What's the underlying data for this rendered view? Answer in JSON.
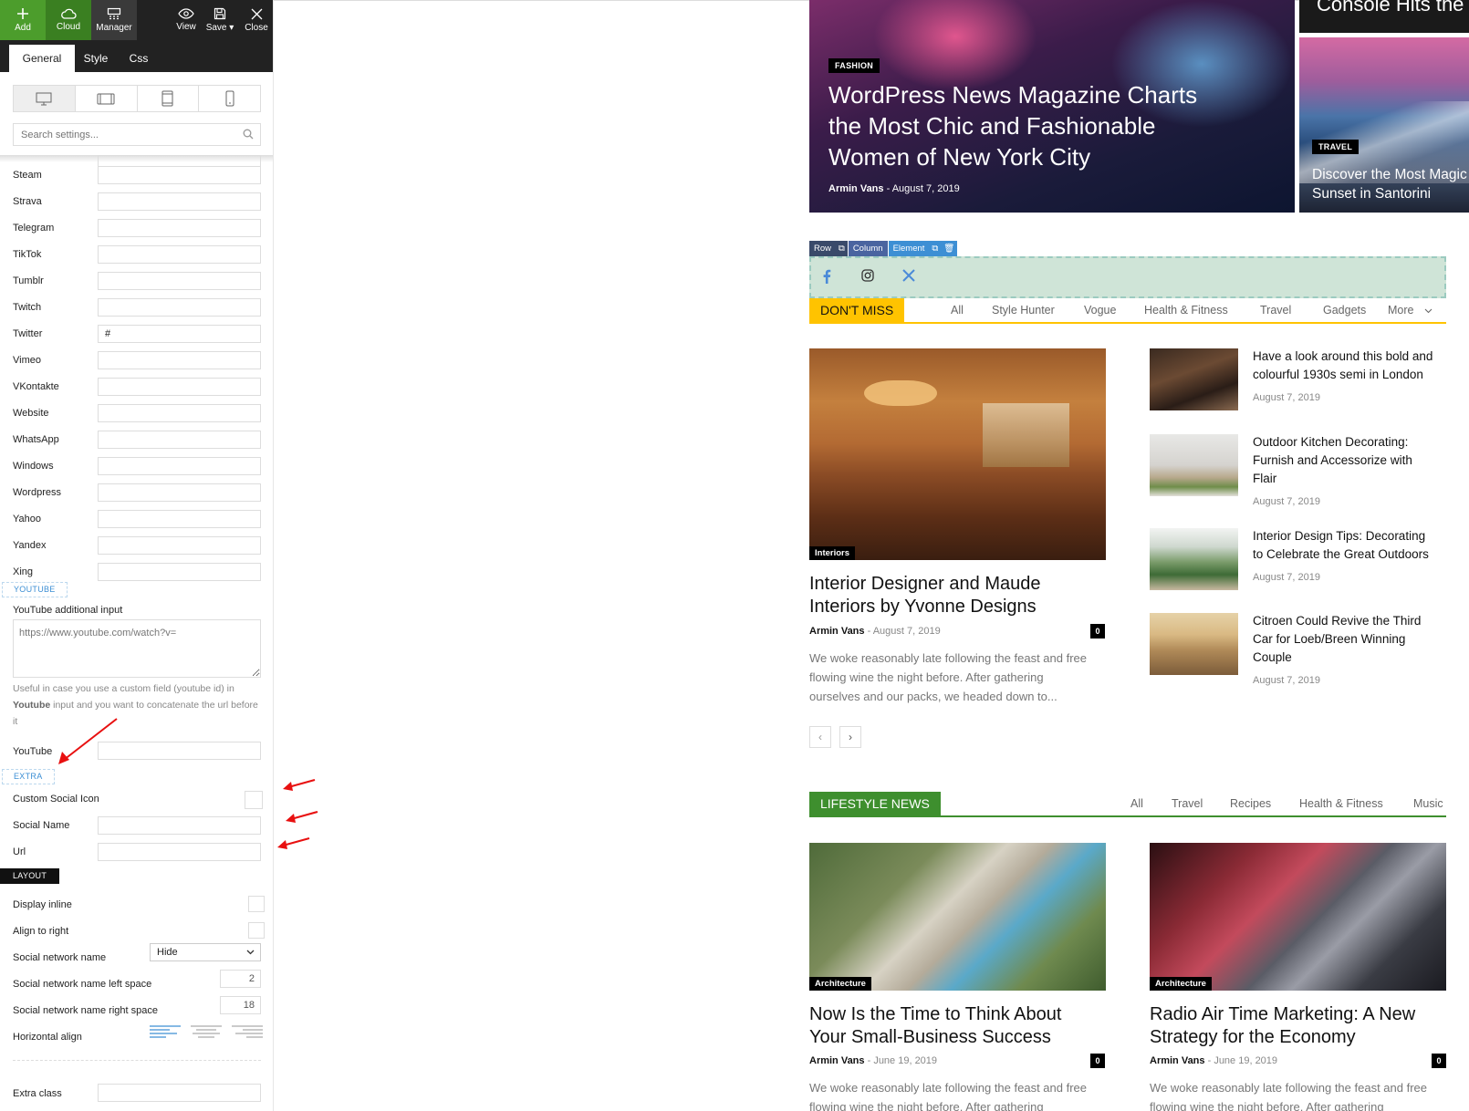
{
  "toolbar": {
    "add": "Add",
    "cloud": "Cloud",
    "manager": "Manager",
    "view": "View",
    "save": "Save",
    "close": "Close"
  },
  "tabs": [
    "General",
    "Style",
    "Css"
  ],
  "search": {
    "placeholder": "Search settings..."
  },
  "social_fields": [
    {
      "label": "Steam",
      "value": ""
    },
    {
      "label": "Strava",
      "value": ""
    },
    {
      "label": "Telegram",
      "value": ""
    },
    {
      "label": "TikTok",
      "value": ""
    },
    {
      "label": "Tumblr",
      "value": ""
    },
    {
      "label": "Twitch",
      "value": ""
    },
    {
      "label": "Twitter",
      "value": "#"
    },
    {
      "label": "Vimeo",
      "value": ""
    },
    {
      "label": "VKontakte",
      "value": ""
    },
    {
      "label": "Website",
      "value": ""
    },
    {
      "label": "WhatsApp",
      "value": ""
    },
    {
      "label": "Windows",
      "value": ""
    },
    {
      "label": "Wordpress",
      "value": ""
    },
    {
      "label": "Yahoo",
      "value": ""
    },
    {
      "label": "Yandex",
      "value": ""
    },
    {
      "label": "Xing",
      "value": ""
    }
  ],
  "youtube": {
    "section": "YOUTUBE",
    "additional_label": "YouTube additional input",
    "additional_value": "https://www.youtube.com/watch?v=",
    "help_1": "Useful in case you use a custom field (youtube id) in ",
    "help_bold": "Youtube",
    "help_2": " input and you want to concatenate the url before it",
    "field_label": "YouTube"
  },
  "extra": {
    "section": "EXTRA",
    "custom_icon": "Custom Social Icon",
    "social_name": "Social Name",
    "url": "Url"
  },
  "layout": {
    "section": "LAYOUT",
    "display_inline": "Display inline",
    "align_right": "Align to right",
    "network_name": "Social network name",
    "network_name_value": "Hide",
    "left_space": "Social network name left space",
    "left_space_value": "2",
    "right_space": "Social network name right space",
    "right_space_value": "18",
    "horizontal_align": "Horizontal align",
    "extra_class": "Extra class"
  },
  "hero": {
    "main": {
      "category": "FASHION",
      "title_lines": [
        "WordPress News Magazine Charts",
        "the Most Chic and Fashionable",
        "Women of New York City"
      ],
      "author": "Armin Vans",
      "date": "August 7, 2019"
    },
    "top_right_title": "Console Hits the",
    "side": {
      "category": "TRAVEL",
      "title_lines": [
        "Discover the Most Magic",
        "Sunset in Santorini"
      ]
    }
  },
  "edit_bar": {
    "row": "Row",
    "column": "Column",
    "element": "Element"
  },
  "dont_miss": {
    "label": "DON'T MISS",
    "filters": [
      "All",
      "Style Hunter",
      "Vogue",
      "Health & Fitness",
      "Travel",
      "Gadgets",
      "More"
    ],
    "main_post": {
      "category": "Interiors",
      "title_lines": [
        "Interior Designer and Maude",
        "Interiors by Yvonne Designs"
      ],
      "author": "Armin Vans",
      "date": "August 7, 2019",
      "comments": "0",
      "excerpt_lines": [
        "We woke reasonably late following the feast and free",
        "flowing wine the night before. After gathering",
        "ourselves and our packs, we headed down to..."
      ]
    },
    "side_posts": [
      {
        "title_lines": [
          "Have a look around this bold and",
          "colourful 1930s semi in London"
        ],
        "date": "August 7, 2019"
      },
      {
        "title_lines": [
          "Outdoor Kitchen Decorating:",
          "Furnish and Accessorize with",
          "Flair"
        ],
        "date": "August 7, 2019"
      },
      {
        "title_lines": [
          "Interior Design Tips: Decorating",
          "to Celebrate the Great Outdoors"
        ],
        "date": "August 7, 2019"
      },
      {
        "title_lines": [
          "Citroen Could Revive the Third",
          "Car for Loeb/Breen Winning",
          "Couple"
        ],
        "date": "August 7, 2019"
      }
    ],
    "pager_prev": "‹",
    "pager_next": "›"
  },
  "lifestyle": {
    "label": "LIFESTYLE NEWS",
    "filters": [
      "All",
      "Travel",
      "Recipes",
      "Health & Fitness",
      "Music"
    ],
    "posts": [
      {
        "category": "Architecture",
        "title_lines": [
          "Now Is the Time to Think About",
          "Your Small-Business Success"
        ],
        "author": "Armin Vans",
        "date": "June 19, 2019",
        "comments": "0",
        "excerpt_lines": [
          "We woke reasonably late following the feast and free",
          "flowing wine the night before. After gathering"
        ]
      },
      {
        "category": "Architecture",
        "title_lines": [
          "Radio Air Time Marketing: A New",
          "Strategy for the Economy"
        ],
        "author": "Armin Vans",
        "date": "June 19, 2019",
        "comments": "0",
        "excerpt_lines": [
          "We woke reasonably late following the feast and free",
          "flowing wine the night before. After gathering"
        ]
      }
    ]
  },
  "colors": {
    "add_green": "#4c9d2c",
    "dont_miss_yellow": "#ffc300",
    "lifestyle_green": "#3e8f2e",
    "editor_blue": "#3d8fd4",
    "annotation_red": "#e81010"
  }
}
